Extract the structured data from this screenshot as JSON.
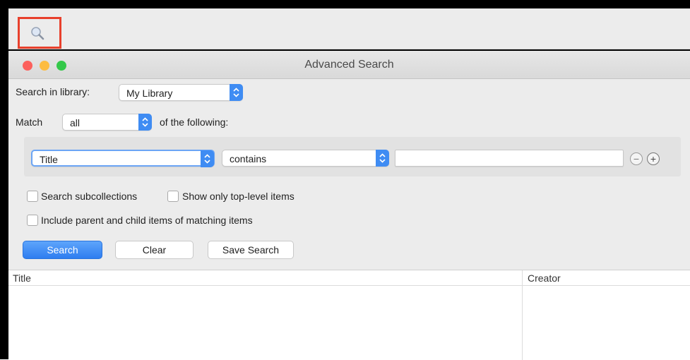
{
  "outer_toolbar": {
    "search_toggle_icon": "magnifier-icon",
    "highlight_color": "#e8402c"
  },
  "window": {
    "title": "Advanced Search",
    "traffic_lights": {
      "close": "#fc605c",
      "minimize": "#fdbc40",
      "zoom": "#34c84a"
    }
  },
  "library": {
    "label": "Search in library:",
    "selected": "My Library"
  },
  "match": {
    "label": "Match",
    "selected": "all",
    "suffix": "of the following:"
  },
  "condition": {
    "field": "Title",
    "operator": "contains",
    "value": "",
    "remove_icon": "minus-circle-icon",
    "add_icon": "plus-circle-icon"
  },
  "options": {
    "search_subcollections": {
      "label": "Search subcollections",
      "checked": false
    },
    "top_level_only": {
      "label": "Show only top-level items",
      "checked": false
    },
    "include_parent_child": {
      "label": "Include parent and child items of matching items",
      "checked": false
    }
  },
  "buttons": {
    "search": "Search",
    "clear": "Clear",
    "save": "Save Search"
  },
  "results": {
    "columns": [
      "Title",
      "Creator"
    ]
  },
  "accent_color": "#3f8cf3"
}
